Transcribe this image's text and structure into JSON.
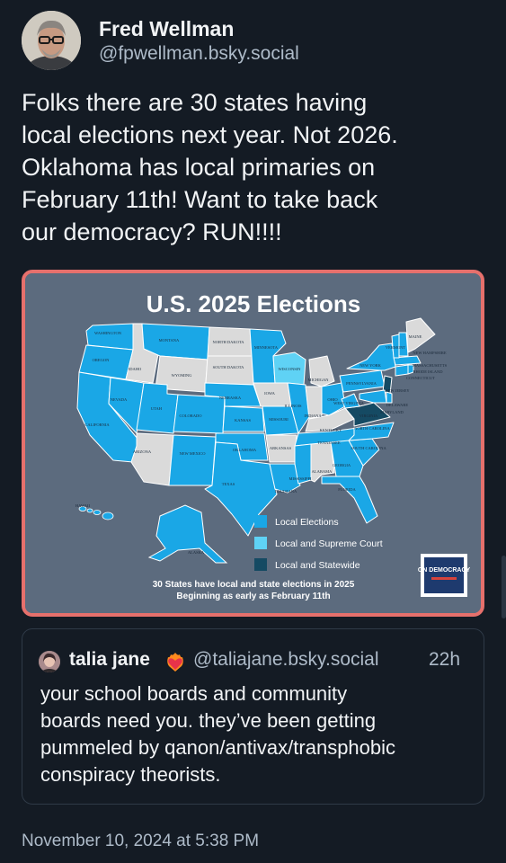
{
  "author": {
    "name": "Fred Wellman",
    "handle": "@fpwellman.bsky.social"
  },
  "post": {
    "text": "Folks there are 30 states having\nlocal elections next year. Not 2026.\nOklahoma has local primaries on\nFebruary 11th! Want to take back\nour democracy? RUN!!!!",
    "timestamp": "November 10, 2024 at 5:38 PM"
  },
  "map_image": {
    "title": "U.S. 2025 Elections",
    "legend": [
      {
        "label": "Local Elections",
        "color": "#1aa7e6"
      },
      {
        "label": "Local and Supreme Court",
        "color": "#5fd2f5"
      },
      {
        "label": "Local and Statewide",
        "color": "#154a63"
      }
    ],
    "caption_line1": "30 States have local and state elections in 2025",
    "caption_line2": "Beginning as early as February 11th",
    "logo_text": "ON DEMOCRACY",
    "no_election_color": "#dadada",
    "states": {
      "washington": "WASHINGTON",
      "oregon": "OREGON",
      "california": "CALIFORNIA",
      "nevada": "NEVADA",
      "idaho": "IDAHO",
      "montana": "MONTANA",
      "wyoming": "WYOMING",
      "utah": "UTAH",
      "arizona": "ARIZONA",
      "colorado": "COLORADO",
      "new_mexico": "NEW MEXICO",
      "north_dakota": "NORTH DAKOTA",
      "south_dakota": "SOUTH DAKOTA",
      "nebraska": "NEBRASKA",
      "kansas": "KANSAS",
      "oklahoma": "OKLAHOMA",
      "texas": "TEXAS",
      "minnesota": "MINNESOTA",
      "iowa": "IOWA",
      "missouri": "MISSOURI",
      "arkansas": "ARKANSAS",
      "louisiana": "LOUISIANA",
      "wisconsin": "WISCONSIN",
      "illinois": "ILLINOIS",
      "michigan": "MICHIGAN",
      "indiana": "INDIANA",
      "ohio": "OHIO",
      "kentucky": "KENTUCKY",
      "tennessee": "TENNESSEE",
      "mississippi": "MISSISSIPPI",
      "alabama": "ALABAMA",
      "georgia": "GEORGIA",
      "florida": "FLORIDA",
      "south_carolina": "SOUTH CAROLINA",
      "north_carolina": "NORTH CAROLINA",
      "virginia": "VIRGINIA",
      "west_virginia": "WEST VIRGINIA",
      "pennsylvania": "PENNSYLVANIA",
      "new_york": "NEW YORK",
      "maine": "MAINE",
      "vermont": "VERMONT",
      "new_hampshire": "NEW HAMPSHIRE",
      "massachusetts": "MASSACHUSETTS",
      "rhode_island": "RHODE ISLAND",
      "connecticut": "CONNECTICUT",
      "new_jersey": "NEW JERSEY",
      "delaware": "DELAWARE",
      "maryland": "MARYLAND",
      "alaska": "ALASKA",
      "hawaii": "HAWAII"
    }
  },
  "quote": {
    "name": "talia jane",
    "handle": "@taliajane.bsky.social",
    "time": "22h",
    "text": "your school boards and community\nboards need you. they’ve been getting\npummeled by qanon/antivax/transphobic\nconspiracy theorists."
  }
}
